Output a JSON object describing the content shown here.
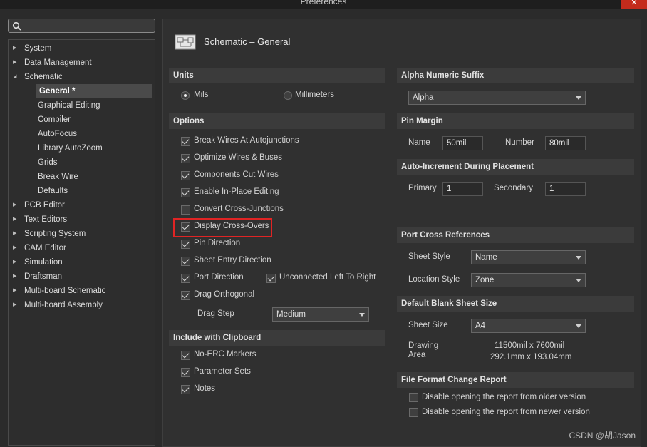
{
  "window": {
    "title": "Preferences",
    "close_glyph": "✕"
  },
  "search": {
    "placeholder": "",
    "value": ""
  },
  "tree": {
    "items": [
      {
        "label": "System",
        "expanded": false
      },
      {
        "label": "Data Management",
        "expanded": false
      },
      {
        "label": "Schematic",
        "expanded": true
      },
      {
        "label": "General *",
        "selected": true
      },
      {
        "label": "Graphical Editing"
      },
      {
        "label": "Compiler"
      },
      {
        "label": "AutoFocus"
      },
      {
        "label": "Library AutoZoom"
      },
      {
        "label": "Grids"
      },
      {
        "label": "Break Wire"
      },
      {
        "label": "Defaults"
      },
      {
        "label": "PCB Editor",
        "expanded": false
      },
      {
        "label": "Text Editors",
        "expanded": false
      },
      {
        "label": "Scripting System",
        "expanded": false
      },
      {
        "label": "CAM Editor",
        "expanded": false
      },
      {
        "label": "Simulation",
        "expanded": false
      },
      {
        "label": "Draftsman",
        "expanded": false
      },
      {
        "label": "Multi-board Schematic",
        "expanded": false
      },
      {
        "label": "Multi-board Assembly",
        "expanded": false
      }
    ]
  },
  "page": {
    "title": "Schematic – General"
  },
  "units": {
    "header": "Units",
    "mils": "Mils",
    "millimeters": "Millimeters",
    "selected": "Mils"
  },
  "options": {
    "header": "Options",
    "break_wires": "Break Wires At Autojunctions",
    "optimize_wires": "Optimize Wires & Buses",
    "components_cut": "Components Cut Wires",
    "enable_inplace": "Enable In-Place Editing",
    "convert_cross": "Convert Cross-Junctions",
    "display_crossovers": "Display Cross-Overs",
    "pin_direction": "Pin Direction",
    "sheet_entry_direction": "Sheet Entry Direction",
    "port_direction": "Port Direction",
    "unconnected_ltr": "Unconnected Left To Right",
    "drag_orthogonal": "Drag Orthogonal",
    "drag_step_label": "Drag Step",
    "drag_step_value": "Medium"
  },
  "clipboard": {
    "header": "Include with Clipboard",
    "no_erc": "No-ERC Markers",
    "parameter_sets": "Parameter Sets",
    "notes": "Notes"
  },
  "alpha_suffix": {
    "header": "Alpha Numeric Suffix",
    "value": "Alpha"
  },
  "pin_margin": {
    "header": "Pin Margin",
    "name_label": "Name",
    "name_value": "50mil",
    "number_label": "Number",
    "number_value": "80mil"
  },
  "auto_increment": {
    "header": "Auto-Increment During Placement",
    "primary_label": "Primary",
    "primary_value": "1",
    "secondary_label": "Secondary",
    "secondary_value": "1"
  },
  "port_cross": {
    "header": "Port Cross References",
    "sheet_style_label": "Sheet Style",
    "sheet_style_value": "Name",
    "location_style_label": "Location Style",
    "location_style_value": "Zone"
  },
  "blank_sheet": {
    "header": "Default Blank Sheet Size",
    "sheet_size_label": "Sheet Size",
    "sheet_size_value": "A4",
    "drawing_area_label_1": "Drawing",
    "drawing_area_label_2": "Area",
    "area_mil": "11500mil x 7600mil",
    "area_mm": "292.1mm x 193.04mm"
  },
  "file_format": {
    "header": "File Format Change Report",
    "disable_older": "Disable opening the report from older version",
    "disable_newer": "Disable opening the report from newer version"
  },
  "watermark": "CSDN @胡Jason"
}
